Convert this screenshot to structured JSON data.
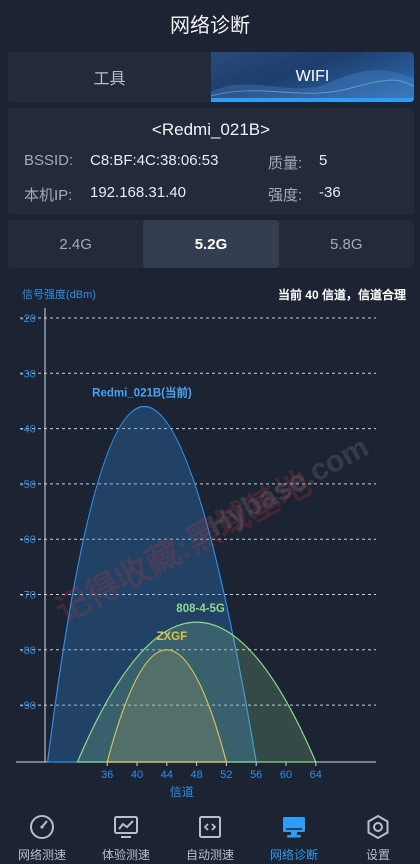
{
  "header": {
    "title": "网络诊断"
  },
  "main_tabs": [
    {
      "label": "工具",
      "active": false
    },
    {
      "label": "WIFI",
      "active": true
    }
  ],
  "info": {
    "ssid": "<Redmi_021B>",
    "bssid_label": "BSSID:",
    "bssid": "C8:BF:4C:38:06:53",
    "quality_label": "质量:",
    "quality": "5",
    "ip_label": "本机IP:",
    "ip": "192.168.31.40",
    "strength_label": "强度:",
    "strength": "-36"
  },
  "band_tabs": [
    {
      "label": "2.4G",
      "active": false
    },
    {
      "label": "5.2G",
      "active": true
    },
    {
      "label": "5.8G",
      "active": false
    }
  ],
  "chart_header": {
    "ylabel": "信号强度(dBm)",
    "status": "当前 40 信道，信道合理"
  },
  "chart_data": {
    "type": "area",
    "ylabel": "信号强度(dBm)",
    "xlabel": "信道",
    "y_ticks": [
      "-20",
      "-30",
      "-40",
      "-50",
      "-60",
      "-70",
      "-80",
      "-90"
    ],
    "x_ticks": [
      "36",
      "40",
      "44",
      "48",
      "52",
      "56",
      "60",
      "64"
    ],
    "ylim": [
      -100,
      -20
    ],
    "x_ticks_values": [
      36,
      40,
      44,
      48,
      52,
      56,
      60,
      64
    ],
    "series": [
      {
        "name": "Redmi_021B(当前)",
        "center": 40,
        "peak": -36,
        "left": 28,
        "right": 56,
        "color": "#2f8fe8",
        "label_color": "#4aa3f5"
      },
      {
        "name": "808-4-5G",
        "center": 48,
        "peak": -75,
        "left": 32,
        "right": 64,
        "color": "#8ed88e",
        "label_color": "#8ed88e"
      },
      {
        "name": "ZXGF",
        "center": 44,
        "peak": -80,
        "left": 36,
        "right": 52,
        "color": "#d8c25a",
        "label_color": "#e0c24a"
      }
    ]
  },
  "watermark": {
    "cn": "记得收藏:黑域基地",
    "en": "Hybase.com"
  },
  "nav": [
    {
      "label": "网络测速",
      "icon": "speedometer-icon",
      "active": false
    },
    {
      "label": "体验测速",
      "icon": "chart-monitor-icon",
      "active": false
    },
    {
      "label": "自动测速",
      "icon": "code-window-icon",
      "active": false
    },
    {
      "label": "网络诊断",
      "icon": "monitor-icon",
      "active": true
    },
    {
      "label": "设置",
      "icon": "gear-icon",
      "active": false
    }
  ]
}
